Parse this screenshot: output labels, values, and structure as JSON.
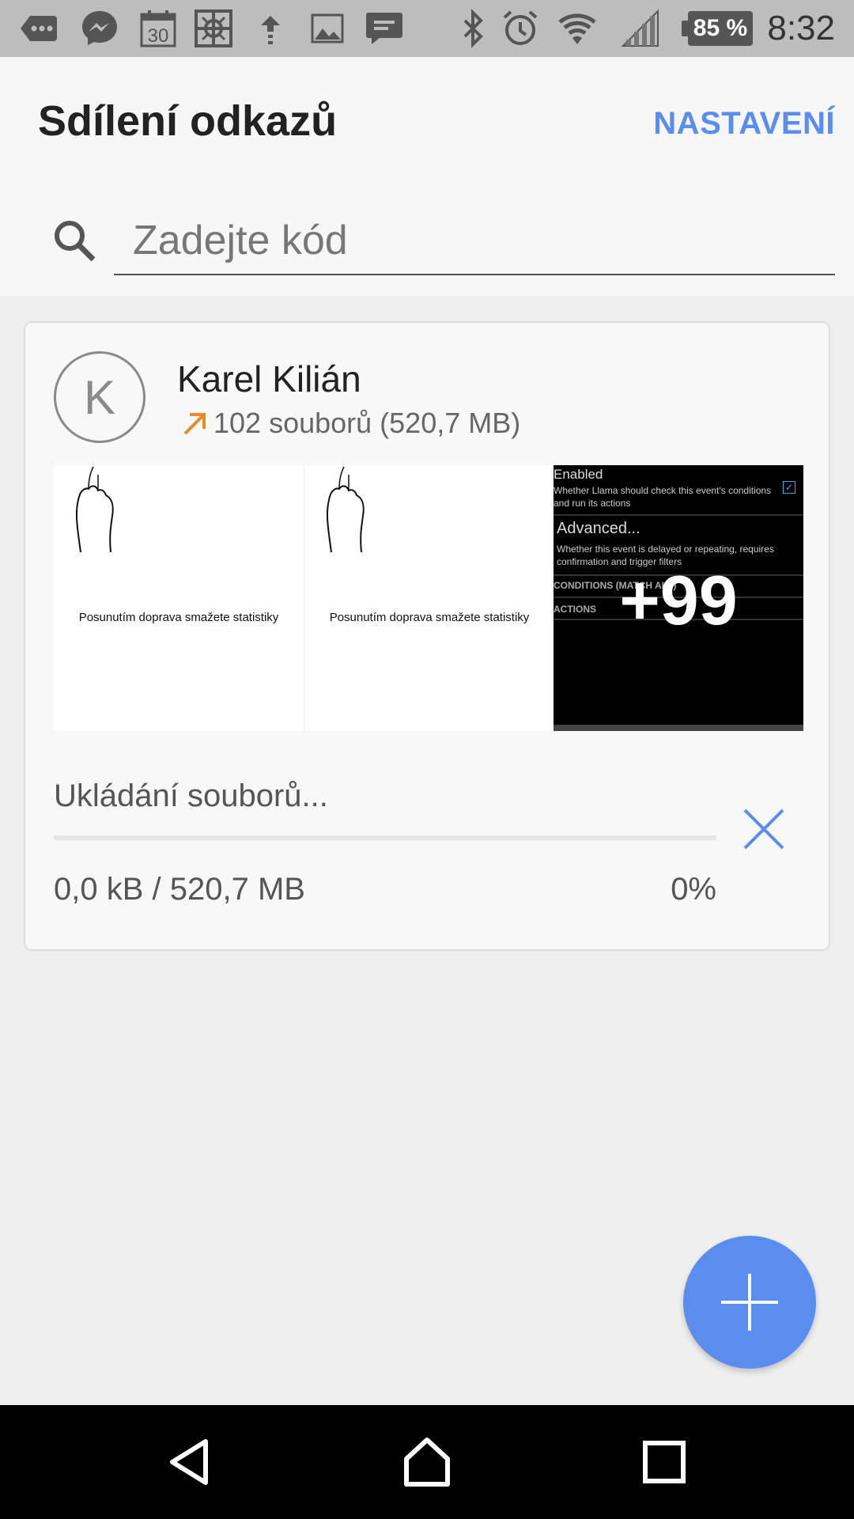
{
  "status_bar": {
    "time": "8:32",
    "battery_percent": "85 %",
    "icons": [
      "more-notifications-icon",
      "messenger-icon",
      "calendar-icon",
      "geocaching-icon",
      "upload-icon",
      "image-icon",
      "message-icon",
      "bluetooth-icon",
      "alarm-icon",
      "wifi-icon",
      "signal-icon"
    ],
    "calendar_day": "30"
  },
  "header": {
    "title": "Sdílení odkazů",
    "settings_label": "NASTAVENÍ",
    "accent_color": "#5b8def"
  },
  "search": {
    "placeholder": "Zadejte kód",
    "value": ""
  },
  "transfer": {
    "avatar_letter": "K",
    "sender_name": "Karel Kilián",
    "files_info": "102 souborů (520,7 MB)",
    "thumbnails": [
      {
        "caption": "Posunutím doprava smažete statistiky"
      },
      {
        "caption": "Posunutím doprava smažete statistiky"
      },
      {
        "lines": [
          "Enabled",
          "Whether Llama should check this event's conditions and run its actions",
          "Advanced...",
          "Whether this event is delayed or repeating, requires confirmation and trigger filters",
          "CONDITIONS (MATCH ALL)",
          "ACTIONS"
        ],
        "more_count": "+99"
      }
    ],
    "status_text": "Ukládání souborů...",
    "progress": 0.0,
    "size_text": "0,0 kB / 520,7 MB",
    "percent_text": "0%"
  },
  "fab": {
    "icon": "plus-icon"
  },
  "nav_bar": {
    "icons": [
      "back-icon",
      "home-icon",
      "recents-icon"
    ]
  }
}
